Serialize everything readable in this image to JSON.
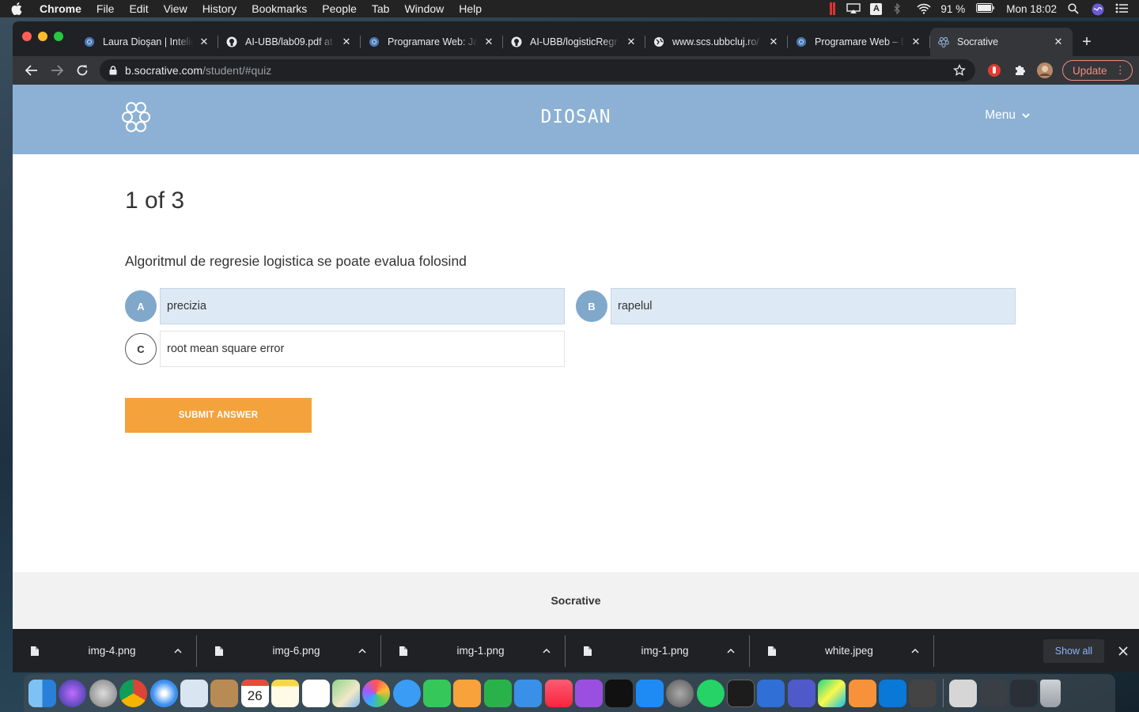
{
  "menubar": {
    "app_name": "Chrome",
    "items": [
      "File",
      "Edit",
      "View",
      "History",
      "Bookmarks",
      "People",
      "Tab",
      "Window",
      "Help"
    ],
    "battery": "91 %",
    "clock": "Mon 18:02",
    "input_badge": "A"
  },
  "tabs": [
    {
      "title": "Laura Dioşan | Intelig",
      "favicon": "socrative-icon"
    },
    {
      "title": "AI-UBB/lab09.pdf at",
      "favicon": "github-icon"
    },
    {
      "title": "Programare Web: Ja",
      "favicon": "socrative-icon"
    },
    {
      "title": "AI-UBB/logisticRegr",
      "favicon": "github-icon"
    },
    {
      "title": "www.scs.ubbcluj.ro/",
      "favicon": "globe-icon"
    },
    {
      "title": "Programare Web – D",
      "favicon": "socrative-icon"
    },
    {
      "title": "Socrative",
      "favicon": "socrative-icon",
      "active": true
    }
  ],
  "address_bar": {
    "host": "b.socrative.com",
    "path": "/student/#quiz"
  },
  "update_label": "Update",
  "site": {
    "room_name": "DIOSAN",
    "menu_label": "Menu",
    "footer_label": "Socrative"
  },
  "quiz": {
    "counter": "1 of 3",
    "question": "Algoritmul de regresie logistica se poate evalua folosind",
    "choices": [
      {
        "letter": "A",
        "text": "precizia",
        "selected": true
      },
      {
        "letter": "B",
        "text": "rapelul",
        "selected": true
      },
      {
        "letter": "C",
        "text": "root mean square error",
        "selected": false
      }
    ],
    "submit_label": "SUBMIT ANSWER"
  },
  "downloads": {
    "items": [
      "img-4.png",
      "img-6.png",
      "img-1.png",
      "img-1.png",
      "white.jpeg"
    ],
    "show_all_label": "Show all"
  },
  "dock": {
    "calendar_day": "26",
    "icons": [
      "finder-icon",
      "siri-icon",
      "launchpad-icon",
      "chrome-icon",
      "safari-icon",
      "preview-icon",
      "contacts-icon",
      "calendar-icon",
      "notes-icon",
      "reminders-icon",
      "maps-icon",
      "photos-icon",
      "messages-icon",
      "facetime-icon",
      "pages-icon",
      "numbers-icon",
      "keynote-icon",
      "music-icon",
      "podcasts-icon",
      "tv-icon",
      "app-store-icon",
      "system-preferences-icon",
      "whatsapp-icon",
      "terminal-icon",
      "activity-monitor-icon",
      "teams-icon",
      "pycharm-icon",
      "sublime-icon",
      "windows-icon",
      "vpn-icon",
      "finder-window-icon",
      "screenshot-icon",
      "screenshot-icon-2",
      "trash-icon"
    ]
  },
  "colors": {
    "header": "#8cb1d4",
    "choice_selected_fill": "#dde9f4",
    "choice_letter": "#7fa8cb",
    "submit": "#f4a23c",
    "update_accent": "#f28b82"
  }
}
